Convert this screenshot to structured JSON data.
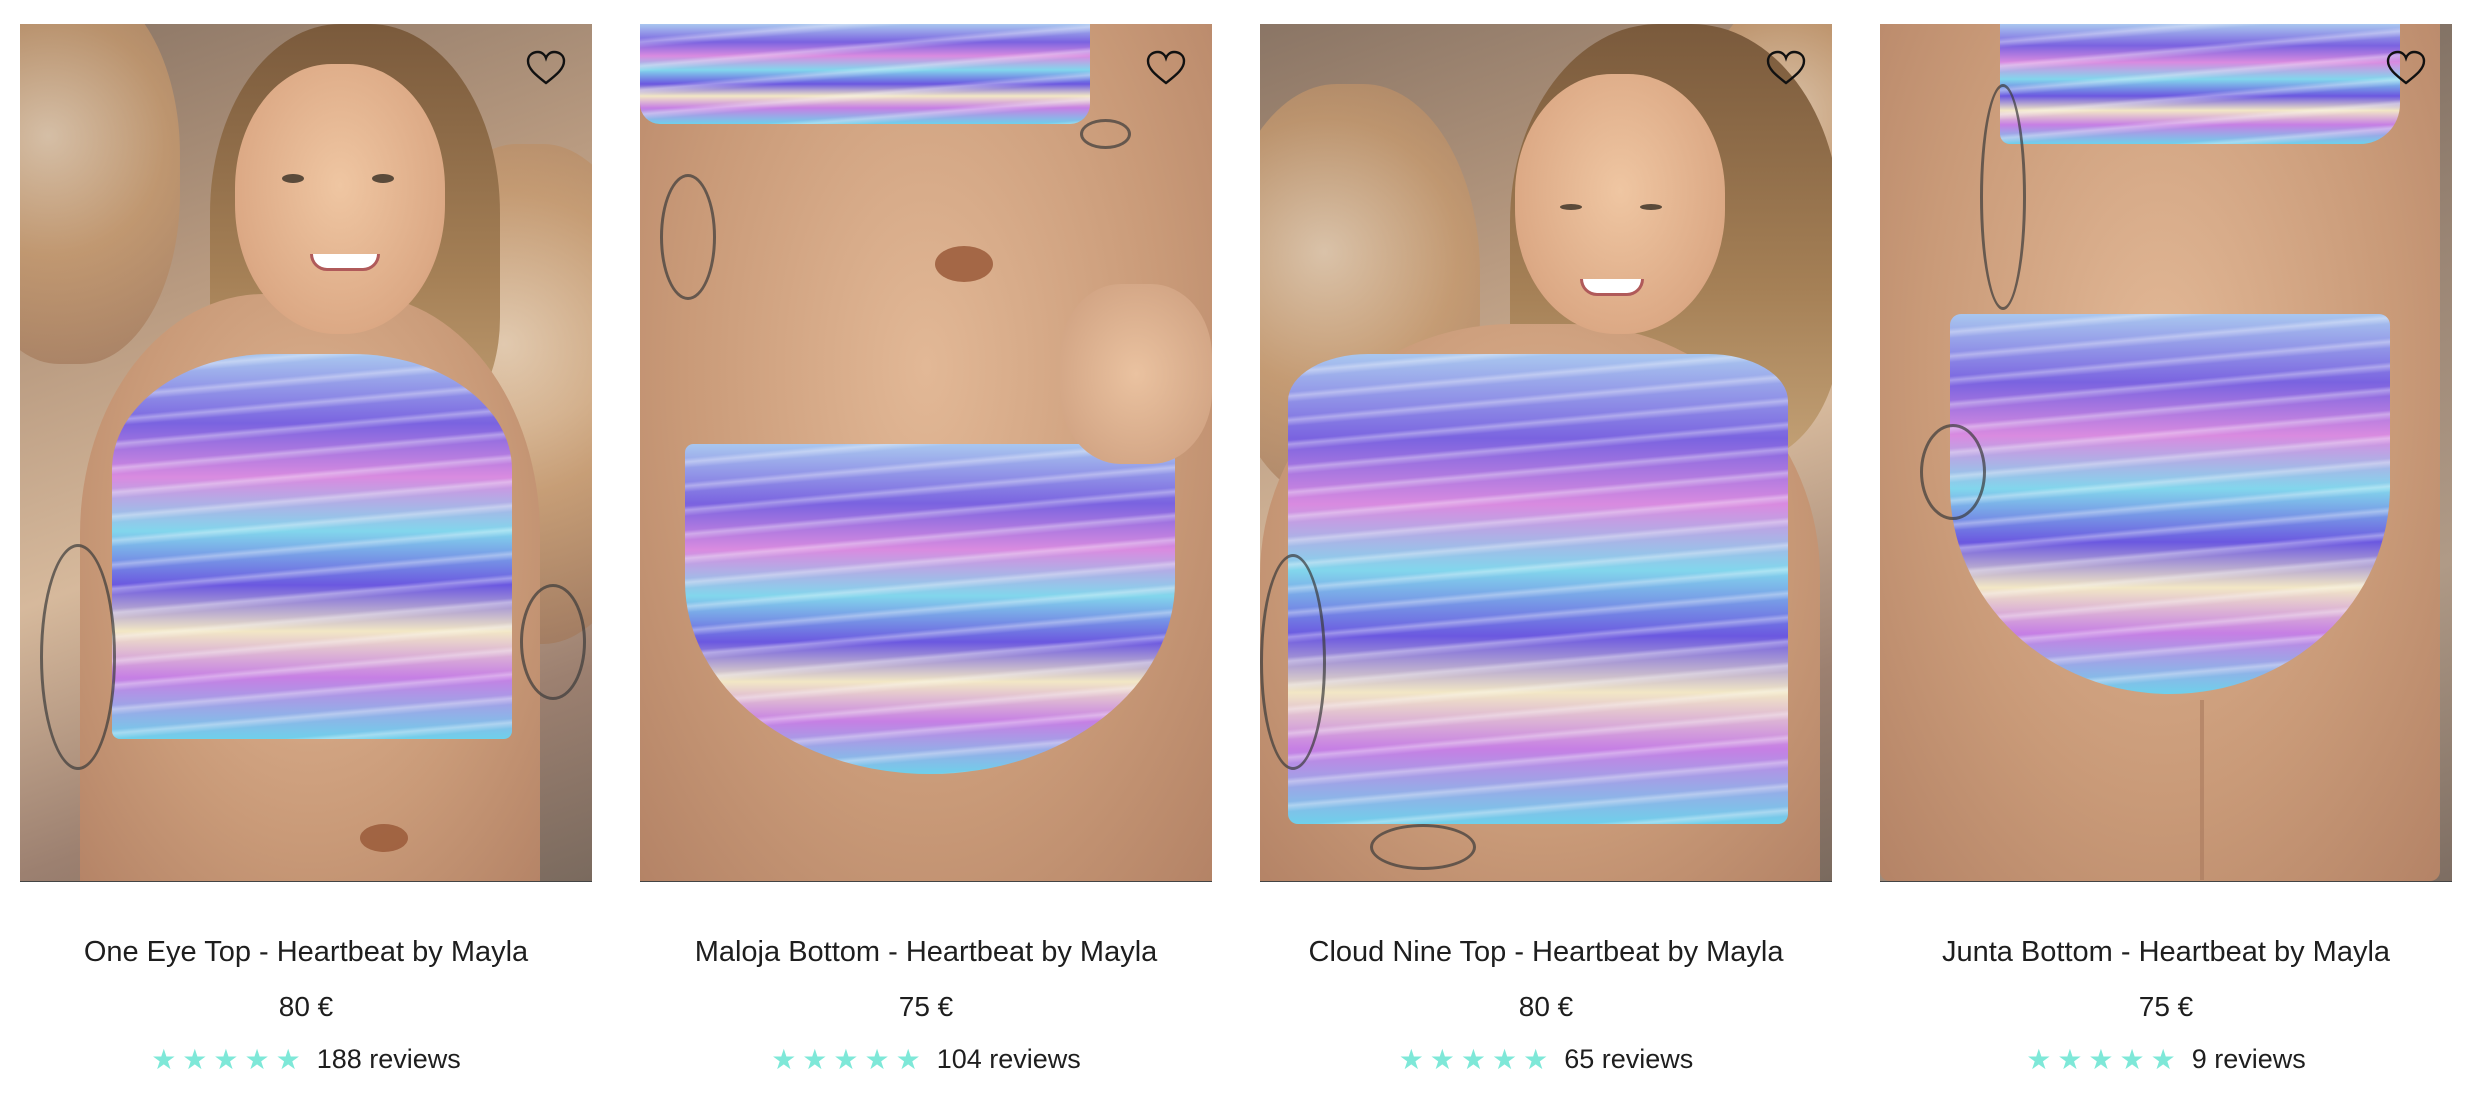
{
  "products": [
    {
      "title": "One Eye Top - Heartbeat by Mayla",
      "price": "80 €",
      "rating": 5,
      "reviews": "188 reviews",
      "image_icon": "product-photo"
    },
    {
      "title": "Maloja Bottom - Heartbeat by Mayla",
      "price": "75 €",
      "rating": 5,
      "reviews": "104 reviews",
      "image_icon": "product-photo"
    },
    {
      "title": "Cloud Nine Top - Heartbeat by Mayla",
      "price": "80 €",
      "rating": 5,
      "reviews": "65 reviews",
      "image_icon": "product-photo"
    },
    {
      "title": "Junta Bottom - Heartbeat by Mayla",
      "price": "75 €",
      "rating": 5,
      "reviews": "9 reviews",
      "image_icon": "product-photo"
    }
  ],
  "colors": {
    "star": "#7ee8d8",
    "text": "#1e1e1e",
    "heart_stroke": "#111111"
  },
  "icons": {
    "wishlist": "heart-outline-icon",
    "star": "star-icon"
  }
}
